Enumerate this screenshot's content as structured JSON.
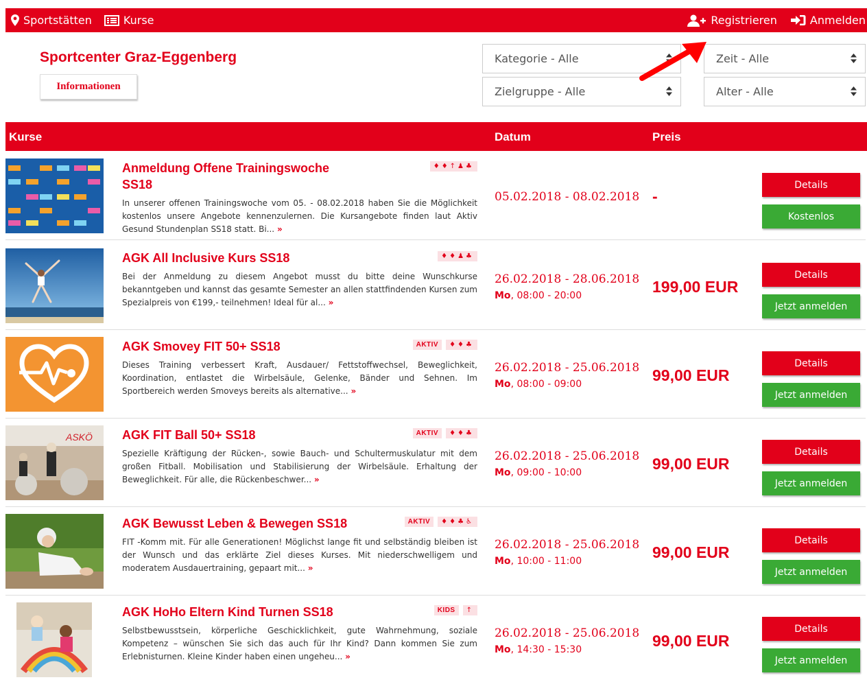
{
  "nav": {
    "sportstaetten": "Sportstätten",
    "kurse": "Kurse",
    "registrieren": "Registrieren",
    "anmelden": "Anmelden"
  },
  "header": {
    "center_title": "Sportcenter Graz-Eggenberg",
    "info_button": "Informationen"
  },
  "filters": {
    "kategorie": "Kategorie - Alle",
    "zeit": "Zeit - Alle",
    "zielgruppe": "Zielgruppe - Alle",
    "alter": "Alter - Alle"
  },
  "table": {
    "col_kurse": "Kurse",
    "col_datum": "Datum",
    "col_preis": "Preis"
  },
  "courses": [
    {
      "title": "Anmeldung Offene Trainingswoche SS18",
      "tag": "",
      "icons": "♦♦↑♟♣",
      "description": "In unserer offenen Trainingswoche vom 05. - 08.02.2018 haben Sie die Möglichkeit kostenlos unsere Angebote kennenzulernen. Die Kursangebote finden laut Aktiv Gesund Stundenplan SS18 statt. Bi...",
      "more": "»",
      "date": "05.02.2018 - 08.02.2018",
      "day": "",
      "time": "",
      "price": "-",
      "details": "Details",
      "action": "Kostenlos"
    },
    {
      "title": "AGK All Inclusive Kurs SS18",
      "tag": "",
      "icons": "♦♦♟♣",
      "description": "Bei der Anmeldung zu diesem Angebot musst du bitte deine Wunschkurse bekanntgeben und kannst das gesamte Semester an allen stattfindenden Kursen zum Spezialpreis von €199,- teilnehmen! Ideal für al...",
      "more": "»",
      "date": "26.02.2018 - 28.06.2018",
      "day": "Mo",
      "time": ", 08:00 - 20:00",
      "price": "199,00 EUR",
      "details": "Details",
      "action": "Jetzt anmelden"
    },
    {
      "title": "AGK Smovey FIT 50+ SS18",
      "tag": "AKTIV",
      "icons": "♦♦♣",
      "description": "Dieses Training verbessert Kraft, Ausdauer/ Fettstoffwechsel, Beweglichkeit, Koordination, entlastet die Wirbelsäule, Gelenke, Bänder und Sehnen. Im Sportbereich werden Smoveys bereits als alternative...",
      "more": "»",
      "date": "26.02.2018 - 25.06.2018",
      "day": "Mo",
      "time": ", 08:00 - 09:00",
      "price": "99,00 EUR",
      "details": "Details",
      "action": "Jetzt anmelden"
    },
    {
      "title": "AGK FIT Ball 50+ SS18",
      "tag": "AKTIV",
      "icons": "♦♦♣",
      "description": "Spezielle Kräftigung der Rücken-, sowie Bauch- und Schultermuskulatur mit dem großen Fitball. Mobilisation und Stabilisierung der Wirbelsäule. Erhaltung der Beweglichkeit. Für alle, die Rückenbeschwer...",
      "more": "»",
      "date": "26.02.2018 - 25.06.2018",
      "day": "Mo",
      "time": ", 09:00 - 10:00",
      "price": "99,00 EUR",
      "details": "Details",
      "action": "Jetzt anmelden"
    },
    {
      "title": "AGK Bewusst Leben & Bewegen SS18",
      "tag": "AKTIV",
      "icons": "♦♦♣♿",
      "description": "FIT -Komm mit. Für alle Generationen! Möglichst lange fit und selbständig bleiben ist der Wunsch und das erklärte Ziel dieses Kurses. Mit niederschwelligem und moderatem Ausdauertraining, gepaart mit...",
      "more": "»",
      "date": "26.02.2018 - 25.06.2018",
      "day": "Mo",
      "time": ", 10:00 - 11:00",
      "price": "99,00 EUR",
      "details": "Details",
      "action": "Jetzt anmelden"
    },
    {
      "title": "AGK HoHo Eltern Kind Turnen SS18",
      "tag": "KIDS",
      "icons": "↑",
      "description": "Selbstbewusstsein, körperliche Geschicklichkeit, gute Wahrnehmung, soziale Kompetenz – wünschen Sie sich das auch für Ihr Kind? Dann kommen Sie zum Erlebnisturnen. Kleine Kinder haben einen ungeheu...",
      "more": "»",
      "date": "26.02.2018 - 25.06.2018",
      "day": "Mo",
      "time": ", 14:30 - 15:30",
      "price": "99,00 EUR",
      "details": "Details",
      "action": "Jetzt anmelden"
    }
  ],
  "colors": {
    "brand_red": "#e2001a",
    "action_green": "#3aaa35"
  }
}
